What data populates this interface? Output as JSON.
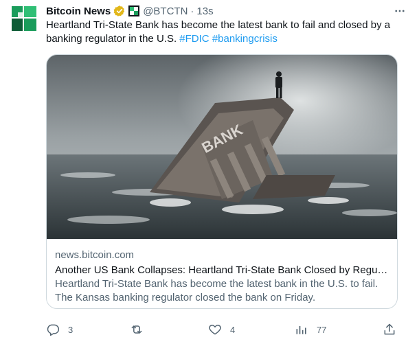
{
  "tweet": {
    "display_name": "Bitcoin News",
    "handle": "@BTCTN",
    "separator": "·",
    "time": "13s",
    "text_main": "Heartland Tri-State Bank has become the latest bank to fail and closed by a banking regulator in the U.S.",
    "hashtags": [
      "#FDIC",
      "#bankingcrisis"
    ]
  },
  "card": {
    "image_sign_text": "BANK",
    "domain": "news.bitcoin.com",
    "title": "Another US Bank Collapses: Heartland Tri-State Bank Closed by Regulators",
    "description": "Heartland Tri-State Bank has become the latest bank in the U.S. to fail. The Kansas banking regulator closed the bank on Friday."
  },
  "actions": {
    "reply_count": "3",
    "retweet_count": "",
    "like_count": "4",
    "views_count": "77"
  },
  "icons": [
    "more-icon",
    "verified-badge-icon",
    "affiliate-icon",
    "reply-icon",
    "retweet-icon",
    "like-icon",
    "views-icon",
    "share-icon"
  ],
  "colors": {
    "link": "#1d9bf0",
    "secondary_text": "#536471",
    "primary_text": "#0f1419",
    "verified_gold": "#e2b719",
    "avatar_green": "#1a9c5b"
  }
}
